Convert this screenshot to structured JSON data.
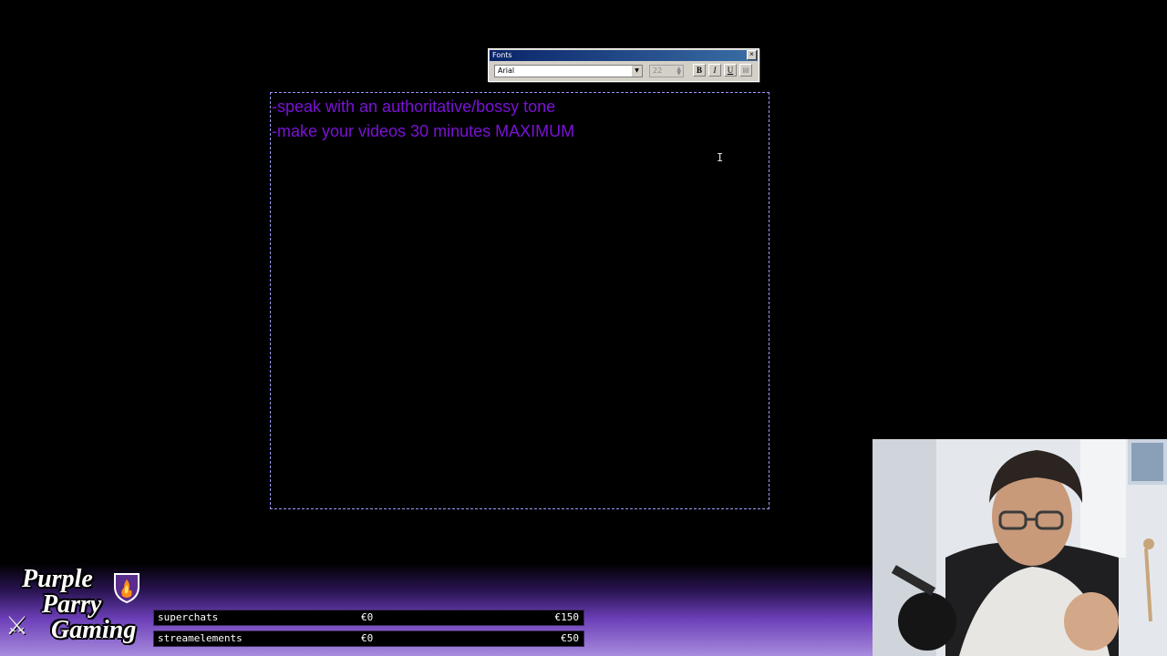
{
  "fonts_toolbar": {
    "title": "Fonts",
    "font_name": "Arial",
    "font_size": "22",
    "bold_label": "B",
    "italic_label": "I",
    "underline_label": "U"
  },
  "text_box": {
    "lines": [
      "-speak with an authoritative/bossy tone",
      "-make your videos 30 minutes MAXIMUM"
    ],
    "text_color": "#7b12d6"
  },
  "logo": {
    "line1": "Purple",
    "line2": "Parry",
    "line3": "Gaming"
  },
  "goals": [
    {
      "label": "superchats",
      "current": "€0",
      "target": "€150"
    },
    {
      "label": "streamelements",
      "current": "€0",
      "target": "€50"
    }
  ]
}
